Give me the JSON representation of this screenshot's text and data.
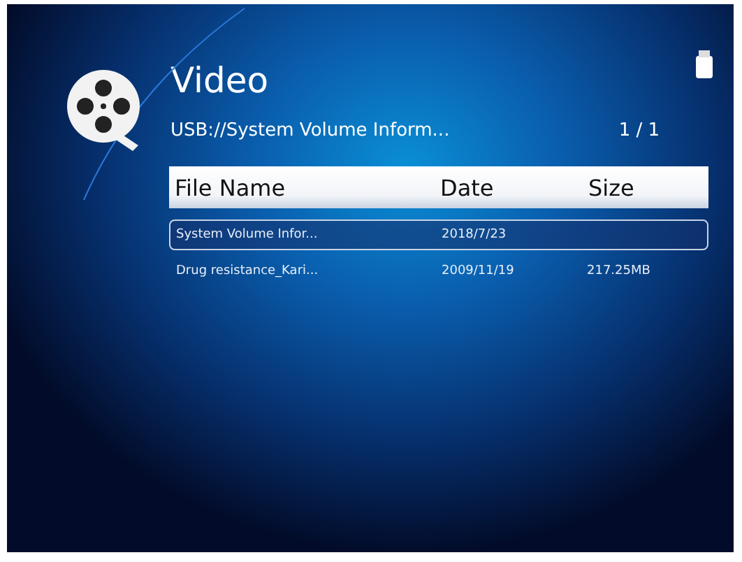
{
  "header": {
    "title": "Video",
    "path": "USB://System Volume Inform...",
    "page": "1 / 1"
  },
  "table": {
    "columns": [
      "File Name",
      "Date",
      "Size"
    ],
    "rows": [
      {
        "name": "System Volume Infor...",
        "date": "2018/7/23",
        "selected": true
      },
      {
        "name": "Drug resistance_Kari...",
        "date": "2009/11/19",
        "size": "217.25MB",
        "selected": false
      }
    ]
  }
}
